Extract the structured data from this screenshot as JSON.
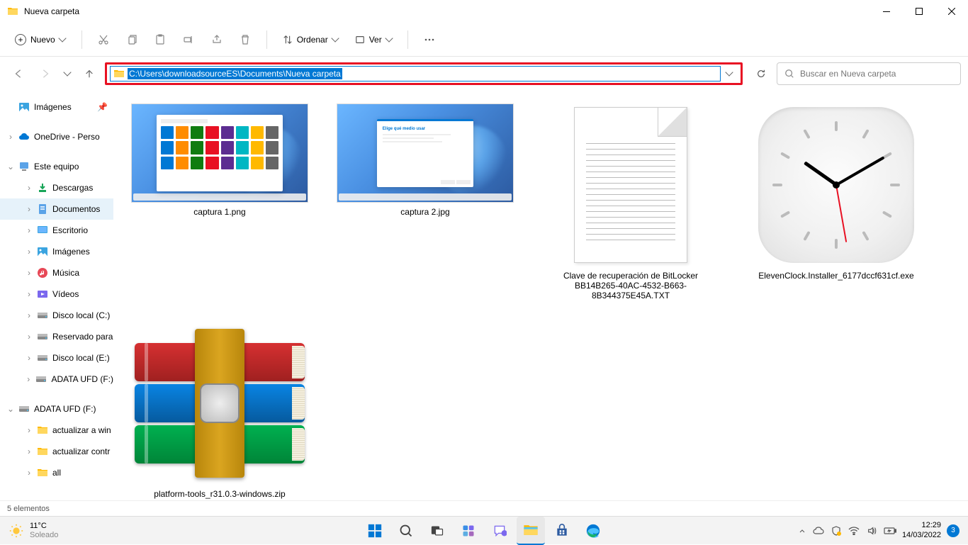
{
  "title": "Nueva carpeta",
  "toolbar": {
    "new": "Nuevo",
    "sort": "Ordenar",
    "view": "Ver"
  },
  "address_path": "C:\\Users\\downloadsourceES\\Documents\\Nueva carpeta",
  "search_placeholder": "Buscar en Nueva carpeta",
  "sidebar_pinned": [
    {
      "label": "Imágenes",
      "icon": "images"
    }
  ],
  "sidebar_cloud": [
    {
      "label": "OneDrive - Perso",
      "icon": "onedrive",
      "chevron": ">"
    }
  ],
  "sidebar_pc": {
    "label": "Este equipo",
    "icon": "pc",
    "chevron": "v"
  },
  "sidebar_pc_children": [
    {
      "label": "Descargas",
      "icon": "downloads"
    },
    {
      "label": "Documentos",
      "icon": "documents",
      "selected": true
    },
    {
      "label": "Escritorio",
      "icon": "desktop"
    },
    {
      "label": "Imágenes",
      "icon": "images"
    },
    {
      "label": "Música",
      "icon": "music"
    },
    {
      "label": "Vídeos",
      "icon": "videos"
    },
    {
      "label": "Disco local (C:)",
      "icon": "drive"
    },
    {
      "label": "Reservado para",
      "icon": "drive"
    },
    {
      "label": "Disco local (E:)",
      "icon": "drive"
    },
    {
      "label": "ADATA UFD (F:)",
      "icon": "usb"
    }
  ],
  "sidebar_ext": {
    "label": "ADATA UFD (F:)",
    "icon": "usb",
    "chevron": "v"
  },
  "sidebar_ext_children": [
    {
      "label": "actualizar a win",
      "icon": "folder"
    },
    {
      "label": "actualizar contr",
      "icon": "folder"
    },
    {
      "label": "all",
      "icon": "folder"
    }
  ],
  "files": [
    {
      "name": "captura 1.png",
      "type": "image1"
    },
    {
      "name": "captura 2.jpg",
      "type": "image2"
    },
    {
      "name": "Clave de recuperación de BitLocker BB14B265-40AC-4532-B663-8B344375E45A.TXT",
      "type": "txt"
    },
    {
      "name": "ElevenClock.Installer_6177dccf631cf.exe",
      "type": "clock"
    },
    {
      "name": "platform-tools_r31.0.3-windows.zip",
      "type": "winrar"
    }
  ],
  "status": "5 elementos",
  "weather": {
    "temp": "11°C",
    "desc": "Soleado"
  },
  "clock": {
    "time": "12:29",
    "date": "14/03/2022"
  },
  "notif_count": "3"
}
